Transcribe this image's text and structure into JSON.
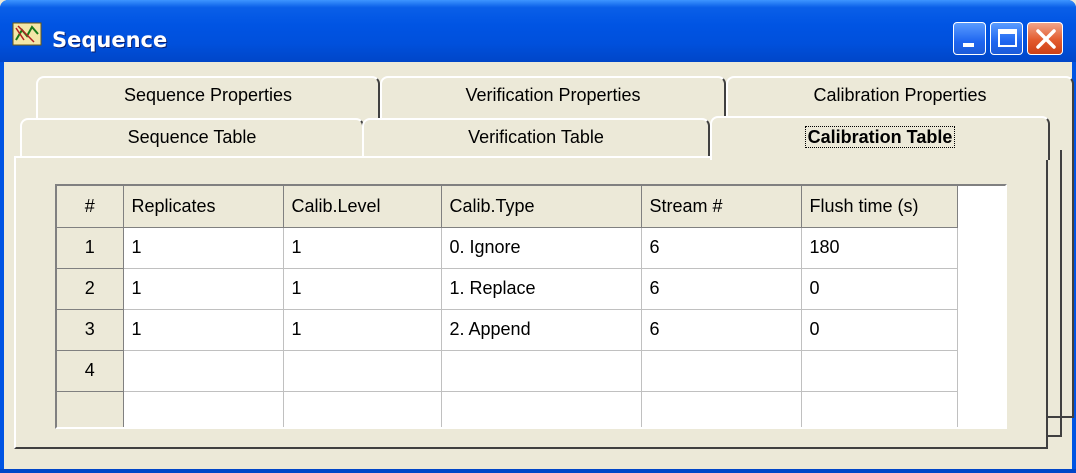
{
  "window": {
    "title": "Sequence",
    "icon": "sequence-app-icon"
  },
  "titlebar_buttons": {
    "minimize": "minimize-icon",
    "maximize": "maximize-icon",
    "close": "close-icon"
  },
  "tabs": {
    "back_row": [
      {
        "label": "Sequence Properties"
      },
      {
        "label": "Verification Properties"
      },
      {
        "label": "Calibration Properties"
      }
    ],
    "front_row": [
      {
        "label": "Sequence Table"
      },
      {
        "label": "Verification Table"
      },
      {
        "label": "Calibration Table",
        "selected": true
      }
    ]
  },
  "grid": {
    "corner": "#",
    "columns": [
      "Replicates",
      "Calib.Level",
      "Calib.Type",
      "Stream #",
      "Flush time (s)"
    ],
    "rows": [
      {
        "num": "1",
        "cells": [
          "1",
          "1",
          "0. Ignore",
          "6",
          "180"
        ]
      },
      {
        "num": "2",
        "cells": [
          "1",
          "1",
          "1. Replace",
          "6",
          "0"
        ]
      },
      {
        "num": "3",
        "cells": [
          "1",
          "1",
          "2. Append",
          "6",
          "0"
        ]
      },
      {
        "num": "4",
        "cells": [
          "",
          "",
          "",
          "",
          ""
        ]
      },
      {
        "num": "",
        "cells": [
          "",
          "",
          "",
          "",
          ""
        ]
      }
    ]
  },
  "colors": {
    "titlebar": "#0054e3",
    "face": "#ece9d8",
    "close_button": "#e35b2e"
  }
}
